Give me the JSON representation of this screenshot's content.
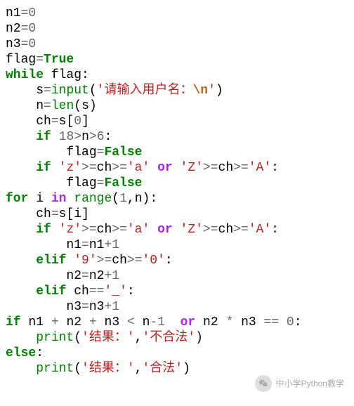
{
  "code": {
    "l1": {
      "v": "n1",
      "eq": "=",
      "n0": "0"
    },
    "l2": {
      "v": "n2",
      "eq": "=",
      "n0": "0"
    },
    "l3": {
      "v": "n3",
      "eq": "=",
      "n0": "0"
    },
    "l4": {
      "v": "flag",
      "eq": "=",
      "t": "True"
    },
    "l5": {
      "wh": "while",
      "v": "flag",
      "c": ":"
    },
    "l6": {
      "v": "s",
      "eq": "=",
      "fn": "input",
      "lp": "(",
      "s1": "'请输入用户名：",
      "esc": "\\n",
      "s2": "'",
      "rp": ")"
    },
    "l7": {
      "v": "n",
      "eq": "=",
      "fn": "len",
      "lp": "(",
      "a": "s",
      "rp": ")"
    },
    "l8": {
      "v": "ch",
      "eq": "=",
      "a": "s",
      "lb": "[",
      "i": "0",
      "rb": "]"
    },
    "l9": {
      "if": "if",
      "n1": "18",
      "g1": ">",
      "v1": "n",
      "g2": ">",
      "n2": "6",
      "c": ":"
    },
    "l10": {
      "v": "flag",
      "eq": "=",
      "f": "False"
    },
    "l11": {
      "if": "if",
      "sz": "'z'",
      "ge1": ">=",
      "ch1": "ch",
      "ge2": ">=",
      "sa": "'a'",
      "or": "or",
      "sZ": "'Z'",
      "ge3": ">=",
      "ch2": "ch",
      "ge4": ">=",
      "sA": "'A'",
      "c": ":"
    },
    "l12": {
      "v": "flag",
      "eq": "=",
      "f": "False"
    },
    "l13": {
      "for": "for",
      "i": "i",
      "in": "in",
      "fn": "range",
      "lp": "(",
      "a1": "1",
      "cm": ",",
      "a2": "n",
      "rp": ")",
      "c": ":"
    },
    "l14": {
      "v": "ch",
      "eq": "=",
      "a": "s",
      "lb": "[",
      "i": "i",
      "rb": "]"
    },
    "l15": {
      "if": "if",
      "sz": "'z'",
      "ge1": ">=",
      "ch1": "ch",
      "ge2": ">=",
      "sa": "'a'",
      "or": "or",
      "sZ": "'Z'",
      "ge3": ">=",
      "ch2": "ch",
      "ge4": ">=",
      "sA": "'A'",
      "c": ":"
    },
    "l16": {
      "v": "n1",
      "eq": "=",
      "v2": "n1",
      "p": "+",
      "n1": "1"
    },
    "l17": {
      "elif": "elif",
      "s9": "'9'",
      "ge1": ">=",
      "ch": "ch",
      "ge2": ">=",
      "s0": "'0'",
      "c": ":"
    },
    "l18": {
      "v": "n2",
      "eq": "=",
      "v2": "n2",
      "p": "+",
      "n1": "1"
    },
    "l19": {
      "elif": "elif",
      "ch": "ch",
      "ee": "==",
      "su": "'_'",
      "c": ":"
    },
    "l20": {
      "v": "n3",
      "eq": "=",
      "v2": "n3",
      "p": "+",
      "n1": "1"
    },
    "l21": {
      "if": "if",
      "a": "n1",
      "p1": "+",
      "b": "n2",
      "p2": "+",
      "c_": "n3",
      "lt": "<",
      "d": "n",
      "m": "-",
      "one": "1",
      "or": "or",
      "e": "n2",
      "st": "*",
      "f": "n3",
      "ee": "==",
      "z": "0",
      "col": ":"
    },
    "l22": {
      "fn": "print",
      "lp": "(",
      "s1": "'结果：'",
      "cm": ",",
      "s2": "'不合法'",
      "rp": ")"
    },
    "l23": {
      "el": "else",
      "c": ":"
    },
    "l24": {
      "fn": "print",
      "lp": "(",
      "s1": "'结果：'",
      "cm": ",",
      "s2": "'合法'",
      "rp": ")"
    }
  },
  "watermark": {
    "text": "中小学Python教学"
  }
}
